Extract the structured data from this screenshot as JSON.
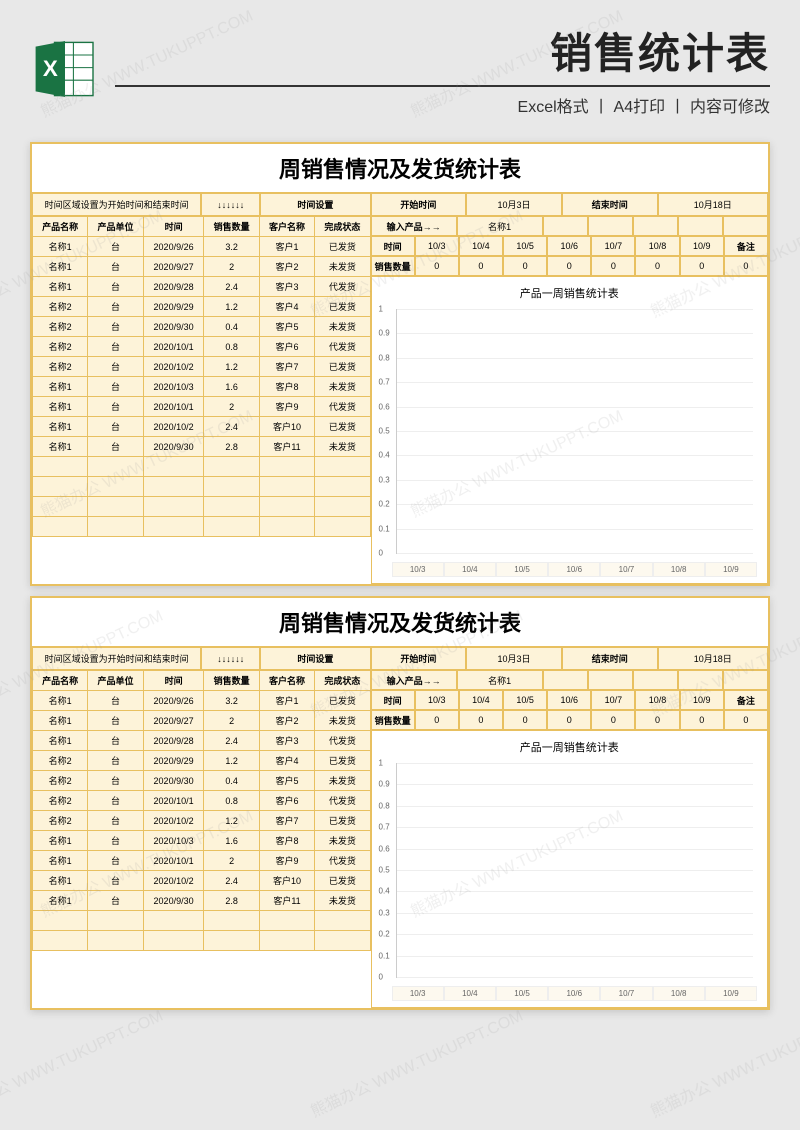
{
  "header": {
    "title": "销售统计表",
    "subtitle": "Excel格式 丨 A4打印 丨 内容可修改",
    "icon_name": "excel-icon"
  },
  "watermark_text": "熊猫办公 WWW.TUKUPPT.COM",
  "sheet": {
    "title": "周销售情况及发货统计表",
    "config": {
      "note": "时间区域设置为开始时间和结束时间",
      "arrows": "↓↓↓↓↓↓",
      "time_setting_label": "时间设置",
      "start_label": "开始时间",
      "start_value": "10月3日",
      "end_label": "结束时间",
      "end_value": "10月18日"
    },
    "left_headers": [
      "产品名称",
      "产品单位",
      "时间",
      "销售数量",
      "客户名称",
      "完成状态"
    ],
    "left_rows": [
      [
        "名称1",
        "台",
        "2020/9/26",
        "3.2",
        "客户1",
        "已发货"
      ],
      [
        "名称1",
        "台",
        "2020/9/27",
        "2",
        "客户2",
        "未发货"
      ],
      [
        "名称1",
        "台",
        "2020/9/28",
        "2.4",
        "客户3",
        "代发货"
      ],
      [
        "名称2",
        "台",
        "2020/9/29",
        "1.2",
        "客户4",
        "已发货"
      ],
      [
        "名称2",
        "台",
        "2020/9/30",
        "0.4",
        "客户5",
        "未发货"
      ],
      [
        "名称2",
        "台",
        "2020/10/1",
        "0.8",
        "客户6",
        "代发货"
      ],
      [
        "名称2",
        "台",
        "2020/10/2",
        "1.2",
        "客户7",
        "已发货"
      ],
      [
        "名称1",
        "台",
        "2020/10/3",
        "1.6",
        "客户8",
        "未发货"
      ],
      [
        "名称1",
        "台",
        "2020/10/1",
        "2",
        "客户9",
        "代发货"
      ],
      [
        "名称1",
        "台",
        "2020/10/2",
        "2.4",
        "客户10",
        "已发货"
      ],
      [
        "名称1",
        "台",
        "2020/9/30",
        "2.8",
        "客户11",
        "未发货"
      ]
    ],
    "empty_rows": 4,
    "right_top": {
      "input_label": "输入产品→→",
      "input_value": "名称1",
      "time_header": "时间",
      "dates": [
        "10/3",
        "10/4",
        "10/5",
        "10/6",
        "10/7",
        "10/8",
        "10/9"
      ],
      "remark_header": "备注",
      "qty_label": "销售数量",
      "qty_values": [
        "0",
        "0",
        "0",
        "0",
        "0",
        "0",
        "0",
        "0"
      ]
    }
  },
  "chart_data": {
    "type": "bar",
    "title": "产品一周销售统计表",
    "categories": [
      "10/3",
      "10/4",
      "10/5",
      "10/6",
      "10/7",
      "10/8",
      "10/9"
    ],
    "values": [
      0,
      0,
      0,
      0,
      0,
      0,
      0
    ],
    "xlabel": "",
    "ylabel": "",
    "ylim": [
      0,
      1
    ],
    "yticks": [
      0,
      0.1,
      0.2,
      0.3,
      0.4,
      0.5,
      0.6,
      0.7,
      0.8,
      0.9,
      1
    ]
  }
}
